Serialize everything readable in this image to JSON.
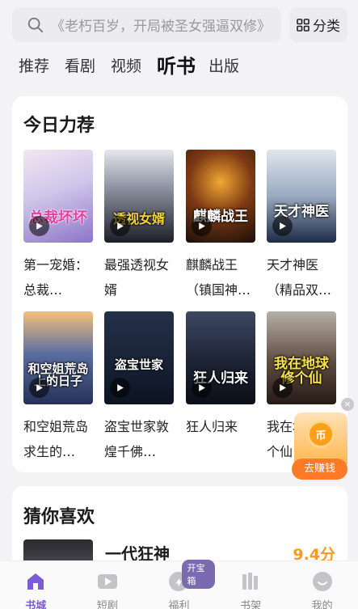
{
  "search": {
    "placeholder": "《老朽百岁，开局被圣女强逼双修》"
  },
  "category_button": {
    "label": "分类"
  },
  "tabs": [
    {
      "label": "推荐",
      "active": false
    },
    {
      "label": "看剧",
      "active": false
    },
    {
      "label": "视频",
      "active": false
    },
    {
      "label": "听书",
      "active": true
    },
    {
      "label": "出版",
      "active": false
    }
  ],
  "featured": {
    "title": "今日力荐",
    "books": [
      {
        "title": "第一宠婚：总裁…",
        "cover_text": "总裁坏坏"
      },
      {
        "title": "最强透视女婿",
        "cover_text": "透视女婿"
      },
      {
        "title": "麒麟战王（镇国神…",
        "cover_text": "麒麟战王"
      },
      {
        "title": "天才神医（精品双…",
        "cover_text": "天才神医"
      },
      {
        "title": "和空姐荒岛求生的…",
        "cover_text": "和空姐荒岛上的日子"
      },
      {
        "title": "盗宝世家敦煌千佛…",
        "cover_text": "盗宝世家"
      },
      {
        "title": "狂人归来",
        "cover_text": "狂人归来"
      },
      {
        "title": "我在地球修个仙",
        "cover_text": "我在地球修个仙"
      }
    ]
  },
  "earn_widget": {
    "coin_text": "币",
    "label": "去赚钱",
    "close": "×"
  },
  "guess": {
    "title": "猜你喜欢",
    "item": {
      "title": "一代狂神",
      "score": "9.4分"
    }
  },
  "nav": {
    "items": [
      {
        "label": "书城",
        "active": true
      },
      {
        "label": "短剧",
        "active": false
      },
      {
        "label": "福利",
        "active": false,
        "badge": "开宝箱"
      },
      {
        "label": "书架",
        "active": false
      },
      {
        "label": "我的",
        "active": false
      }
    ]
  },
  "colors": {
    "accent": "#7b5cd6",
    "score": "#f59a23",
    "earn": "#ff7a26"
  }
}
